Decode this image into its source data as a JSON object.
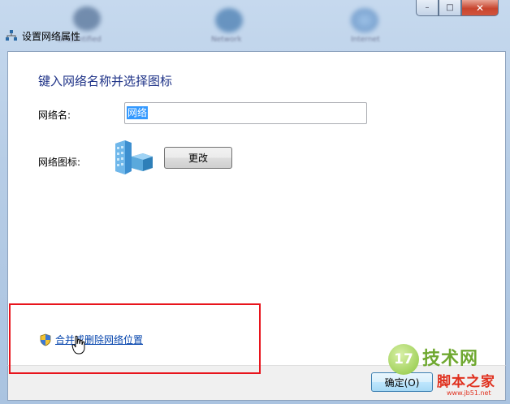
{
  "window": {
    "title": "设置网络属性",
    "caption": {
      "minimize": "–",
      "maximize": "□",
      "close": "✕"
    }
  },
  "background_labels": [
    "Unidentified",
    "Network",
    "Internet"
  ],
  "main": {
    "heading": "键入网络名称并选择图标",
    "network_name_label": "网络名:",
    "network_name_value": "网络",
    "network_icon_label": "网络图标:",
    "change_button": "更改",
    "merge_link": "合并或删除网络位置"
  },
  "footer": {
    "ok_button": "确定(O)"
  },
  "watermark": {
    "badge": "17",
    "title": "技术网",
    "subtitle": "脚本之家",
    "url": "www.jb51.net"
  },
  "colors": {
    "heading": "#1e3287",
    "link": "#0645ad",
    "highlight_box": "#e8141c",
    "selection": "#3399ff"
  },
  "icons": [
    "network-icon",
    "network-location-icon",
    "shield-icon",
    "hand-cursor-icon",
    "close-icon"
  ]
}
